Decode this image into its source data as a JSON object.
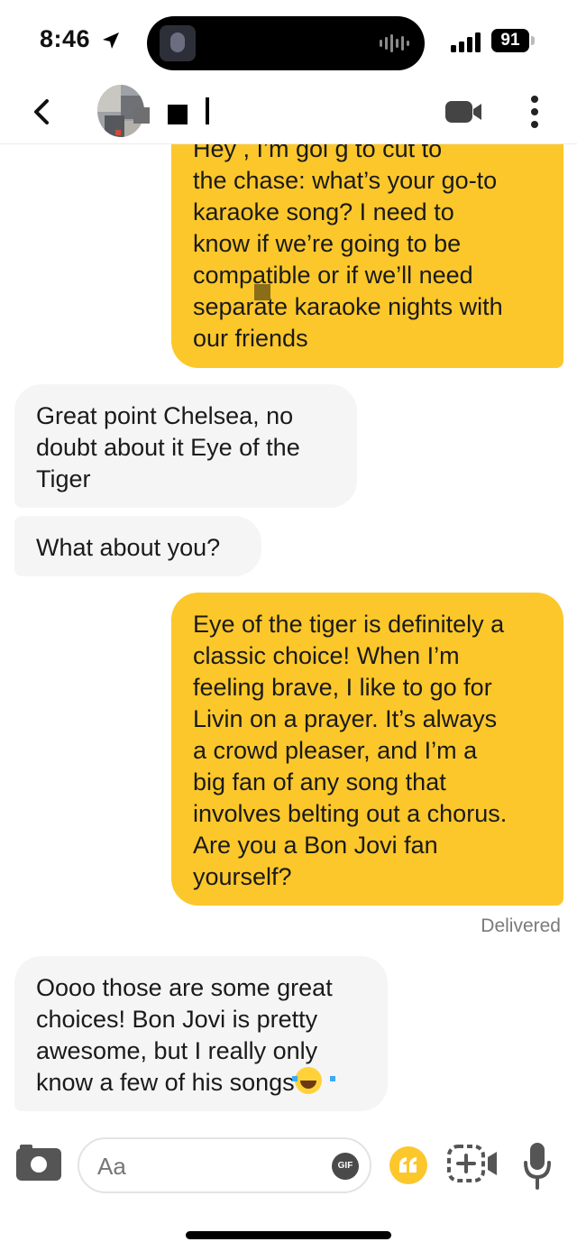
{
  "status_bar": {
    "time": "8:46",
    "battery": "91",
    "icons": [
      "location-arrow-icon",
      "cellular-signal-icon",
      "battery-icon"
    ]
  },
  "header": {
    "icons": [
      "back-chevron-icon",
      "video-call-icon",
      "more-options-icon"
    ]
  },
  "messages": [
    {
      "sender": "me",
      "text": "Hey      , I’m goi g to cut to\nthe chase: what’s your go-to\nkaraoke song? I need to\nknow if we’re going to be\ncompatible or if we’ll need\nseparate karaoke nights with\nour friends"
    },
    {
      "sender": "them",
      "text": "Great point Chelsea, no\ndoubt about it Eye of the\nTiger"
    },
    {
      "sender": "them",
      "text": "What about you?"
    },
    {
      "sender": "me",
      "text": "Eye of the tiger is definitely a\nclassic choice! When I’m\nfeeling brave, I like to go for\nLivin on a prayer. It’s always\na crowd pleaser, and I’m a\nbig fan of any song that\ninvolves belting out a chorus.\nAre you a Bon Jovi fan\nyourself?"
    },
    {
      "sender": "them",
      "text": "Oooo those are some great\nchoices! Bon Jovi is pretty\nawesome, but I really only\nknow a few of his songs",
      "emoji": "tears-of-joy-emoji"
    }
  ],
  "delivered_label": "Delivered",
  "composer": {
    "placeholder": "Aa",
    "gif_label": "GIF",
    "icons": [
      "camera-icon",
      "gif-icon",
      "quote-prompt-icon",
      "sticker-icon",
      "microphone-icon"
    ]
  },
  "colors": {
    "outgoing_bubble": "#fcc72b",
    "incoming_bubble": "#f5f5f5",
    "accent": "#fcc72b"
  }
}
